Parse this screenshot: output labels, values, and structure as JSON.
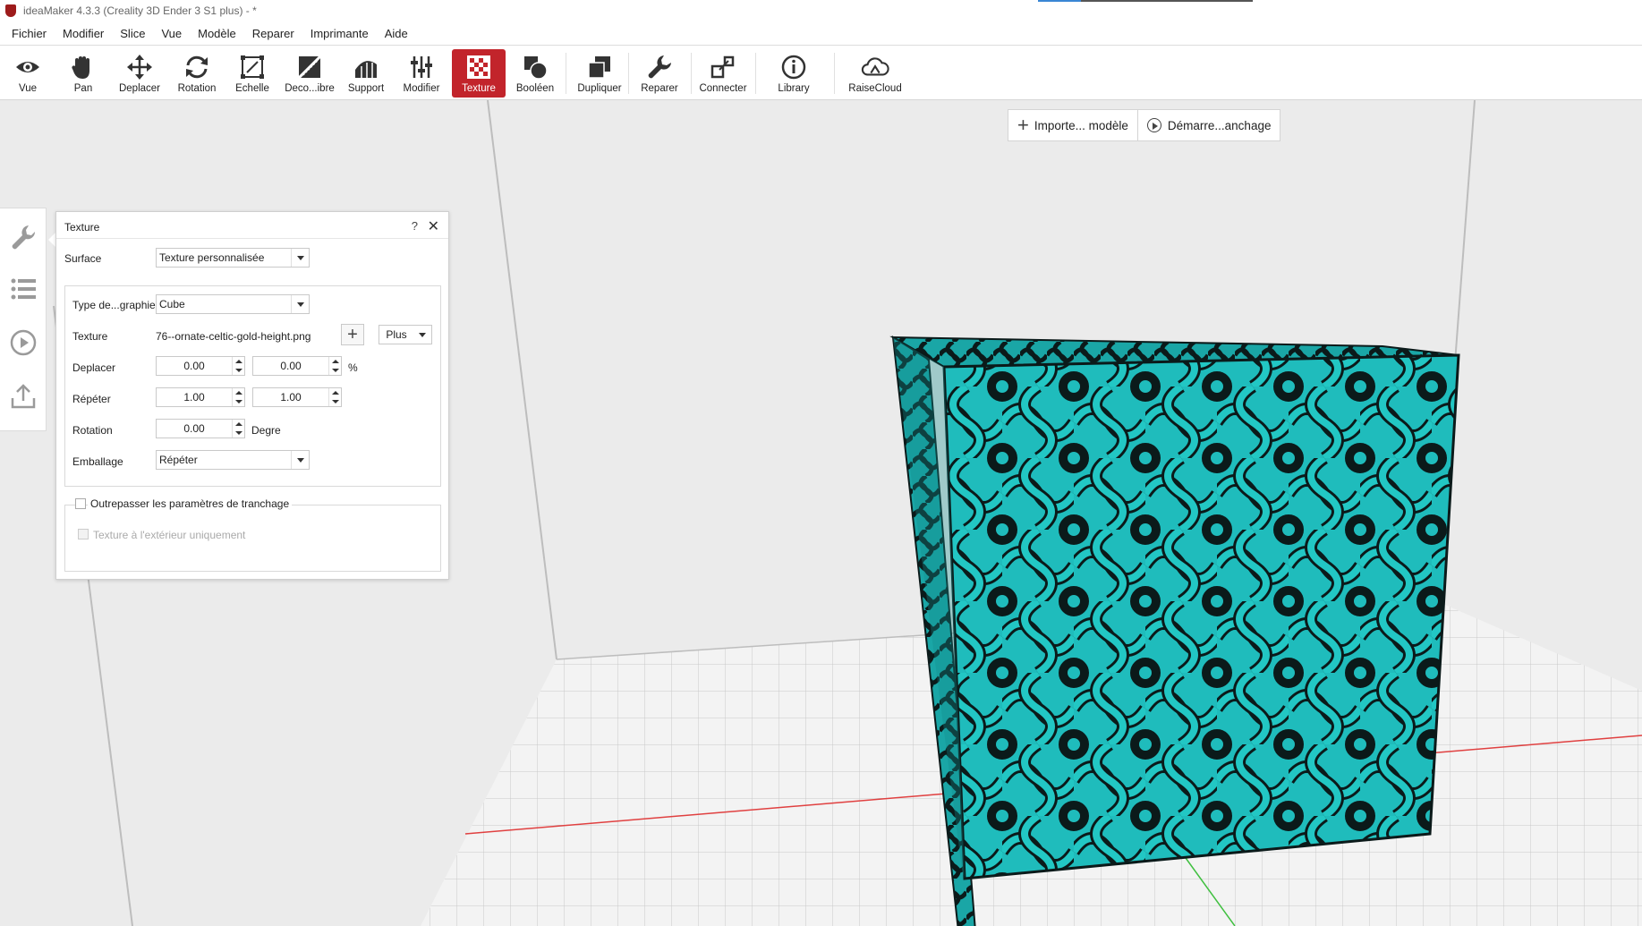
{
  "window": {
    "title": "ideaMaker 4.3.3 (Creality 3D Ender 3 S1 plus) - *"
  },
  "menu": [
    "Fichier",
    "Modifier",
    "Slice",
    "Vue",
    "Modèle",
    "Reparer",
    "Imprimante",
    "Aide"
  ],
  "toolbar": {
    "vue": "Vue",
    "pan": "Pan",
    "deplacer": "Deplacer",
    "rotation": "Rotation",
    "echelle": "Echelle",
    "decoupe": "Deco...ibre",
    "support": "Support",
    "modifier": "Modifier",
    "texture": "Texture",
    "booleen": "Booléen",
    "dupliquer": "Dupliquer",
    "reparer": "Reparer",
    "connecter": "Connecter",
    "library": "Library",
    "raisecloud": "RaiseCloud",
    "active_color": "#c2242b"
  },
  "viewport": {
    "import_label": "Importe... modèle",
    "start_label": "Démarre...anchage"
  },
  "side_icons": [
    "wrench-icon",
    "list-icon",
    "play-circle-icon",
    "upload-icon"
  ],
  "panel": {
    "title": "Texture",
    "help": "?",
    "close": "✕",
    "surface_label": "Surface",
    "surface_value": "Texture personnalisée",
    "projection_label": "Type de...graphie",
    "projection_value": "Cube",
    "texture_label": "Texture",
    "texture_file": "76--ornate-celtic-gold-height.png",
    "more_label": "Plus",
    "offset_label": "Deplacer",
    "offset_x": "0.00",
    "offset_y": "0.00",
    "offset_unit": "%",
    "repeat_label": "Répéter",
    "repeat_x": "1.00",
    "repeat_y": "1.00",
    "rotation_label": "Rotation",
    "rotation_value": "0.00",
    "rotation_unit": "Degre",
    "wrap_label": "Emballage",
    "wrap_value": "Répéter",
    "override_label": "Outrepasser les paramètres de tranchage",
    "exterior_label": "Texture à l'extérieur uniquement"
  },
  "model": {
    "texture_color": "#1fbcbc",
    "line_color": "#0b1a1a"
  }
}
